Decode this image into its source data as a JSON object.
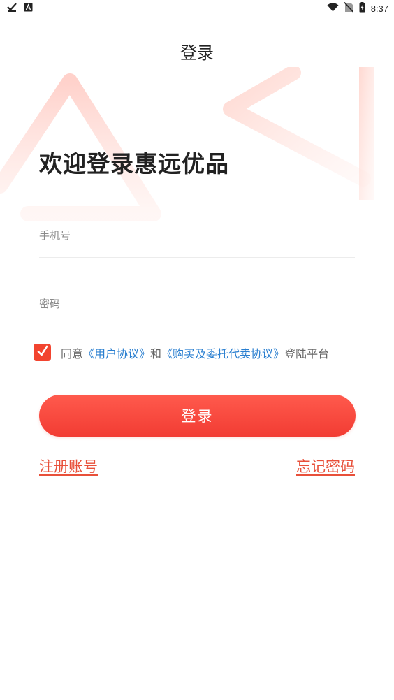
{
  "status_bar": {
    "time": "8:37",
    "icons": [
      "download-done-icon",
      "a-app-icon",
      "wifi-icon",
      "no-sim-icon",
      "battery-charging-icon"
    ]
  },
  "header": {
    "title": "登录"
  },
  "welcome": "欢迎登录惠远优品",
  "form": {
    "phone_placeholder": "手机号",
    "password_placeholder": "密码"
  },
  "agreement": {
    "checked": true,
    "prefix": "同意",
    "user_agreement": "《用户协议》",
    "and": "和",
    "purchase_agreement": "《购买及委托代卖协议》",
    "suffix": "登陆平台"
  },
  "login_button": "登录",
  "links": {
    "register": "注册账号",
    "forgot": "忘记密码"
  },
  "colors": {
    "accent": "#f2442f",
    "link_blue": "#2a7fd0",
    "link_red": "#e8503a"
  }
}
